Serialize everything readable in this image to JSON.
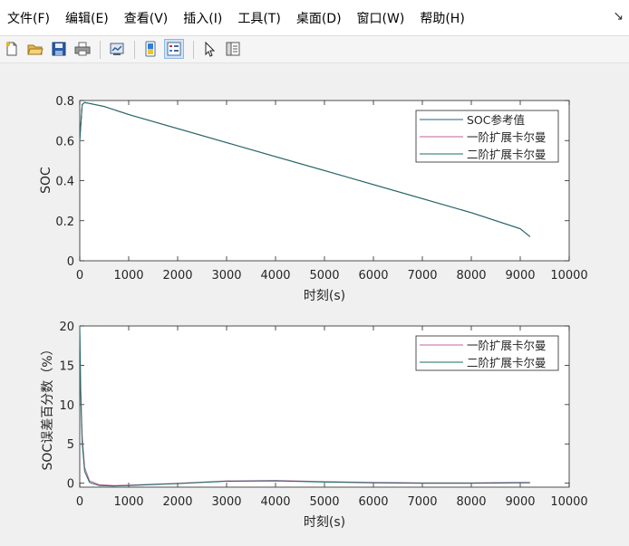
{
  "menu": {
    "items": [
      "文件(F)",
      "编辑(E)",
      "查看(V)",
      "插入(I)",
      "工具(T)",
      "桌面(D)",
      "窗口(W)",
      "帮助(H)"
    ],
    "corner": "↘"
  },
  "toolbar": {
    "icons": [
      "new-figure-icon",
      "open-folder-icon",
      "save-icon",
      "print-icon",
      "link-plot-icon",
      "insert-colorbar-icon",
      "insert-legend-icon",
      "pointer-icon",
      "property-inspector-icon"
    ],
    "active_icon": "insert-legend-icon"
  },
  "colors": {
    "soc_ref": "#1f5f8b",
    "ekf1": "#c0629c",
    "ekf2": "#1b6f67",
    "axes_bg": "#ffffff",
    "figure_bg": "#f0f0f0"
  },
  "chart_data": [
    {
      "type": "line",
      "xlabel": "时刻(s)",
      "ylabel": "SOC",
      "xlim": [
        0,
        10000
      ],
      "ylim": [
        0,
        0.8
      ],
      "xticks": [
        0,
        1000,
        2000,
        3000,
        4000,
        5000,
        6000,
        7000,
        8000,
        9000,
        10000
      ],
      "yticks": [
        0,
        0.2,
        0.4,
        0.6,
        0.8
      ],
      "ytick_labels": [
        "0",
        "0.2",
        "0.4",
        "0.6",
        "0.8"
      ],
      "grid": false,
      "legend_position": "top-right",
      "series": [
        {
          "name": "SOC参考值",
          "color_key": "soc_ref",
          "x": [
            0,
            50,
            100,
            200,
            500,
            1000,
            2000,
            3000,
            4000,
            5000,
            6000,
            7000,
            8000,
            9000,
            9200
          ],
          "y": [
            0.6,
            0.78,
            0.79,
            0.785,
            0.77,
            0.73,
            0.66,
            0.59,
            0.52,
            0.45,
            0.38,
            0.31,
            0.24,
            0.16,
            0.12
          ]
        },
        {
          "name": "一阶扩展卡尔曼",
          "color_key": "ekf1",
          "x": [
            0,
            50,
            100,
            200,
            500,
            1000,
            2000,
            3000,
            4000,
            5000,
            6000,
            7000,
            8000,
            9000,
            9200
          ],
          "y": [
            0.6,
            0.78,
            0.79,
            0.785,
            0.77,
            0.73,
            0.66,
            0.59,
            0.52,
            0.45,
            0.38,
            0.31,
            0.24,
            0.16,
            0.12
          ]
        },
        {
          "name": "二阶扩展卡尔曼",
          "color_key": "ekf2",
          "x": [
            0,
            50,
            100,
            200,
            500,
            1000,
            2000,
            3000,
            4000,
            5000,
            6000,
            7000,
            8000,
            9000,
            9200
          ],
          "y": [
            0.6,
            0.78,
            0.79,
            0.785,
            0.77,
            0.73,
            0.66,
            0.59,
            0.52,
            0.45,
            0.38,
            0.31,
            0.24,
            0.16,
            0.12
          ]
        }
      ]
    },
    {
      "type": "line",
      "xlabel": "时刻(s)",
      "ylabel": "SOC误差百分数（%）",
      "xlim": [
        0,
        10000
      ],
      "ylim": [
        -0.5,
        20
      ],
      "xticks": [
        0,
        1000,
        2000,
        3000,
        4000,
        5000,
        6000,
        7000,
        8000,
        9000,
        10000
      ],
      "yticks": [
        0,
        5,
        10,
        15,
        20
      ],
      "ytick_labels": [
        "0",
        "5",
        "10",
        "15",
        "20"
      ],
      "grid": false,
      "legend_position": "top-right",
      "series": [
        {
          "name": "一阶扩展卡尔曼",
          "color_key": "ekf1",
          "x": [
            0,
            20,
            50,
            100,
            200,
            400,
            700,
            1000,
            2000,
            3000,
            4000,
            5000,
            6000,
            7000,
            8000,
            9000,
            9200
          ],
          "y": [
            20,
            12,
            6,
            2,
            0.3,
            -0.2,
            -0.3,
            -0.25,
            0.0,
            0.3,
            0.35,
            0.2,
            0.1,
            0.05,
            0.05,
            0.1,
            0.1
          ]
        },
        {
          "name": "二阶扩展卡尔曼",
          "color_key": "ekf2",
          "x": [
            0,
            20,
            50,
            100,
            200,
            400,
            700,
            1000,
            2000,
            3000,
            4000,
            5000,
            6000,
            7000,
            8000,
            9000,
            9200
          ],
          "y": [
            20,
            11,
            5,
            1.5,
            0.1,
            -0.3,
            -0.35,
            -0.3,
            -0.05,
            0.25,
            0.3,
            0.15,
            0.05,
            0.0,
            0.0,
            0.05,
            0.05
          ]
        }
      ]
    }
  ]
}
